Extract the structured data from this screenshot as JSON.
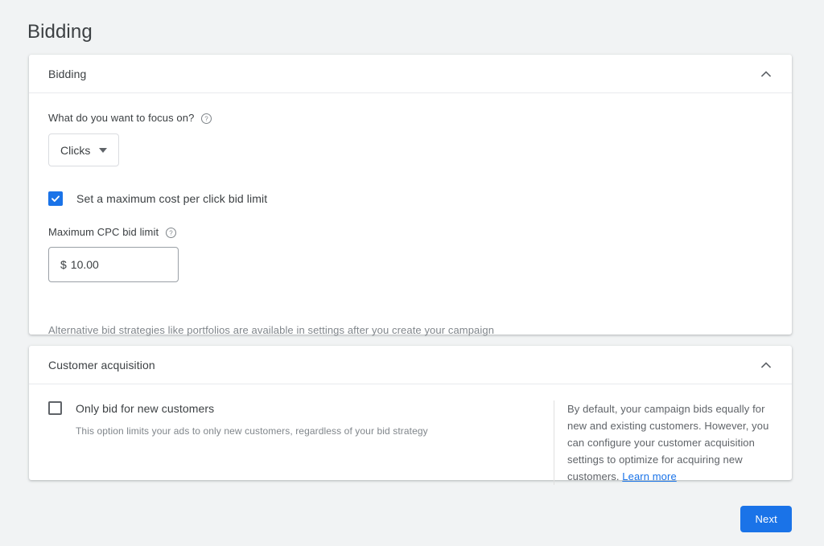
{
  "page": {
    "title": "Bidding",
    "background_color": "#f1f3f4",
    "accent_color": "#1a73e8"
  },
  "bidding_card": {
    "header": "Bidding",
    "collapse_icon": "chevron-up-icon",
    "focus_label": "What do you want to focus on?",
    "focus_help_icon": "help-icon",
    "focus_select_value": "Clicks",
    "focus_select_options": [
      "Clicks"
    ],
    "max_cpc_checkbox_label": "Set a maximum cost per click bid limit",
    "max_cpc_checkbox_checked": true,
    "cpc_field_label": "Maximum CPC bid limit",
    "cpc_help_icon": "help-icon",
    "cpc_currency_symbol": "$",
    "cpc_value": "10.00",
    "note": "Alternative bid strategies like portfolios are available in settings after you create your campaign"
  },
  "customer_acquisition_card": {
    "header": "Customer acquisition",
    "collapse_icon": "chevron-up-icon",
    "only_new_checkbox_label": "Only bid for new customers",
    "only_new_checkbox_checked": false,
    "only_new_description": "This option limits your ads to only new customers, regardless of your bid strategy",
    "info_text": "By default, your campaign bids equally for new and existing customers. However, you can configure your customer acquisition settings to optimize for acquiring new customers. ",
    "info_link": "Learn more"
  },
  "footer": {
    "next_label": "Next"
  }
}
